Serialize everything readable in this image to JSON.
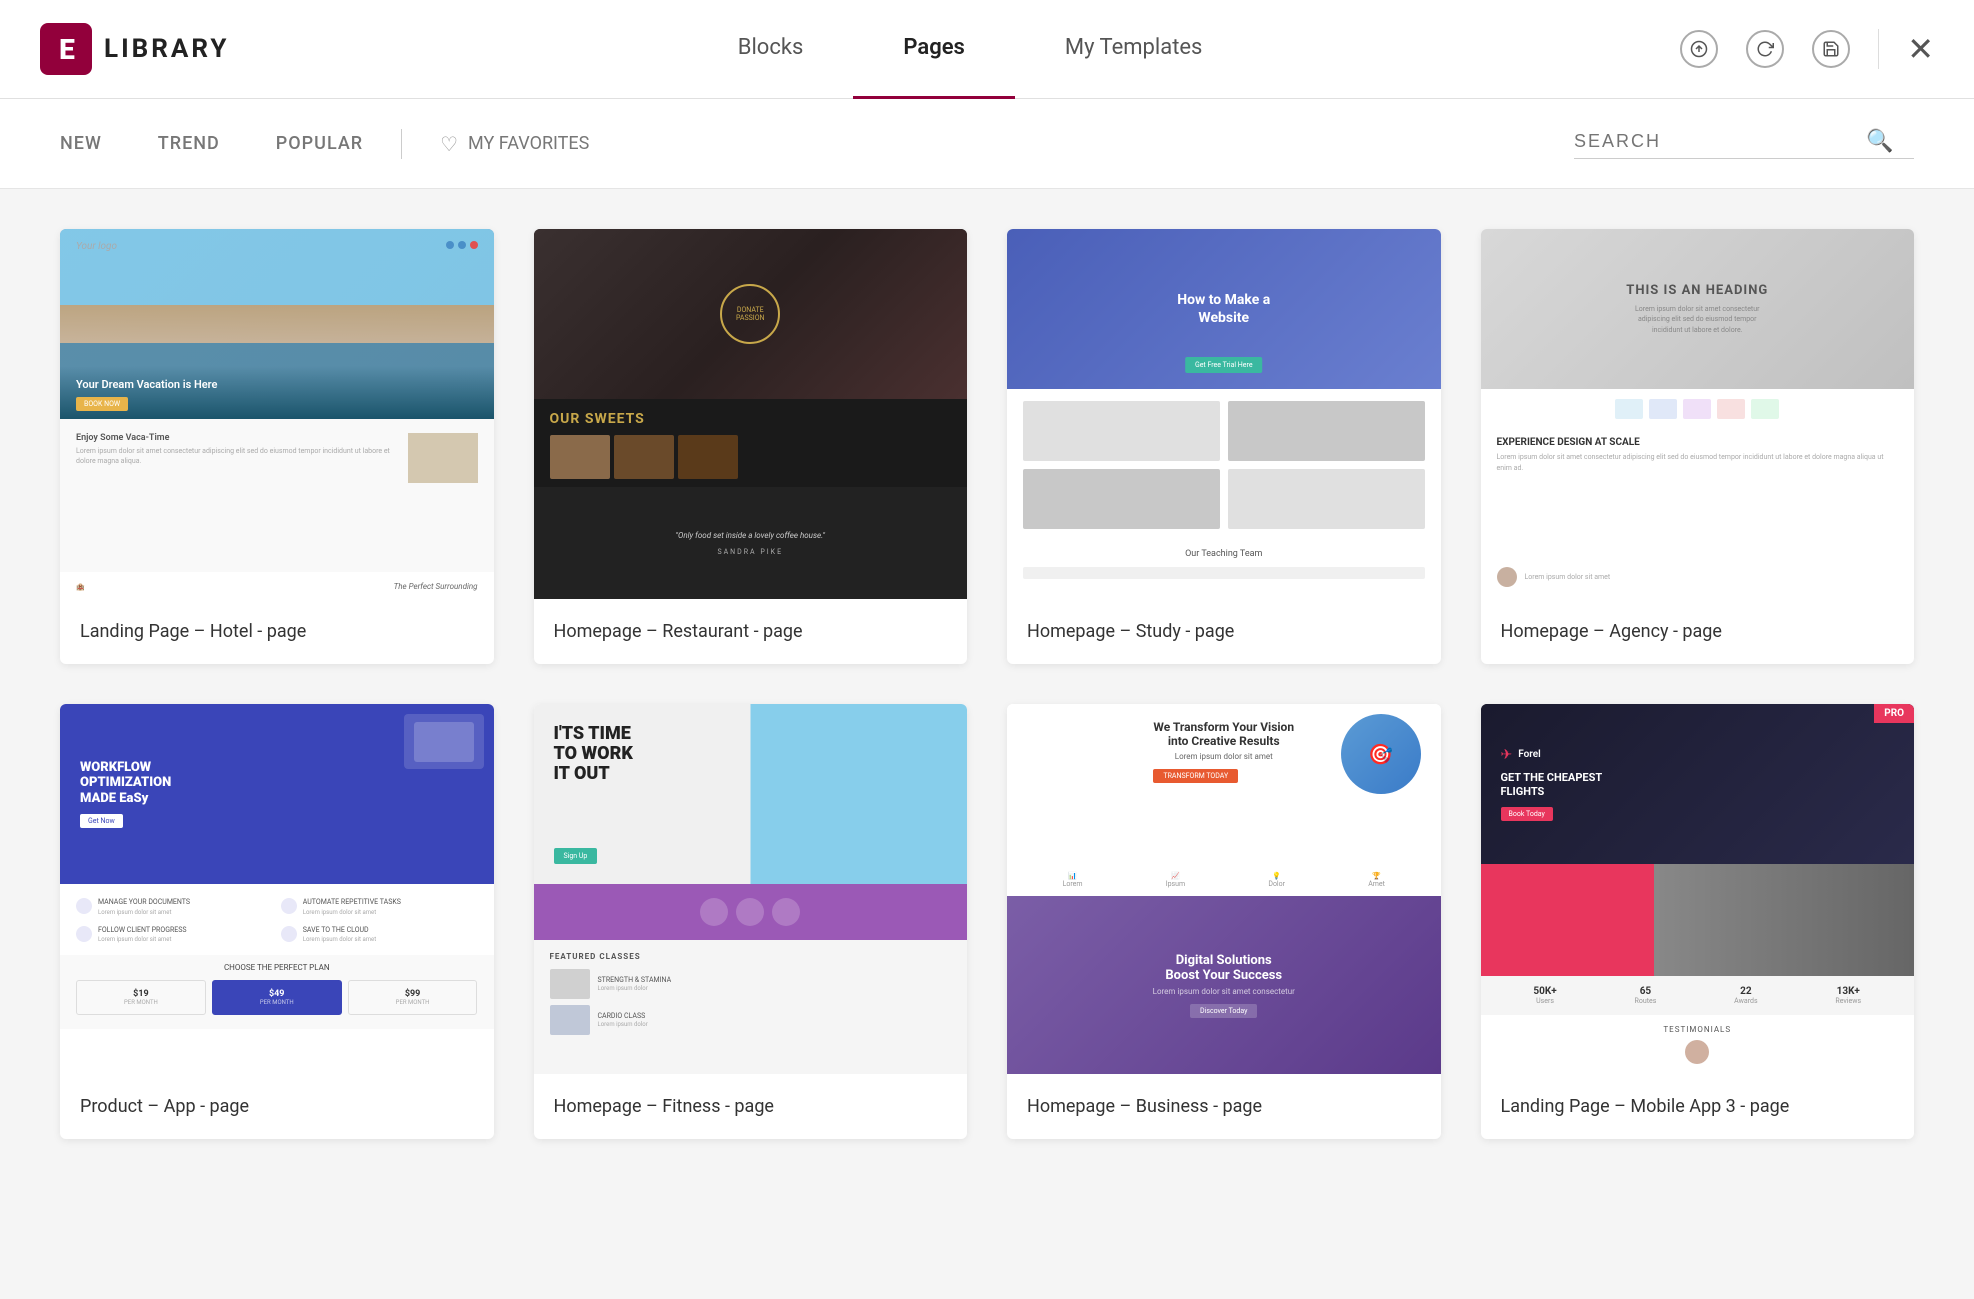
{
  "header": {
    "logo_icon": "E",
    "logo_text": "LIBRARY",
    "tabs": [
      {
        "id": "blocks",
        "label": "Blocks",
        "active": false
      },
      {
        "id": "pages",
        "label": "Pages",
        "active": true
      },
      {
        "id": "my-templates",
        "label": "My Templates",
        "active": false
      }
    ],
    "actions": {
      "upload_title": "Upload",
      "refresh_title": "Refresh",
      "save_title": "Save",
      "close_title": "Close"
    }
  },
  "filter": {
    "items": [
      {
        "id": "new",
        "label": "NEW"
      },
      {
        "id": "trend",
        "label": "TREND"
      },
      {
        "id": "popular",
        "label": "POPULAR"
      }
    ],
    "favorites_label": "MY FAVORITES",
    "search_placeholder": "SEARCH"
  },
  "cards": [
    {
      "id": "hotel",
      "label": "Landing Page – Hotel - page",
      "type": "hotel"
    },
    {
      "id": "restaurant",
      "label": "Homepage – Restaurant - page",
      "type": "restaurant"
    },
    {
      "id": "study",
      "label": "Homepage – Study - page",
      "type": "study"
    },
    {
      "id": "agency",
      "label": "Homepage – Agency - page",
      "type": "agency"
    },
    {
      "id": "app",
      "label": "Product – App - page",
      "type": "app"
    },
    {
      "id": "fitness",
      "label": "Homepage – Fitness - page",
      "type": "fitness"
    },
    {
      "id": "business",
      "label": "Homepage – Business - page",
      "type": "business"
    },
    {
      "id": "mobile",
      "label": "Landing Page – Mobile App 3 - page",
      "type": "mobile",
      "pro": true
    }
  ],
  "thumbnails": {
    "hotel": {
      "logo": "Your logo",
      "title": "Your Dream Vacation is Here",
      "cta": "BOOK NOW",
      "section_title": "Enjoy Some Vaca-Time",
      "caption": "The Perfect Surrounding"
    },
    "restaurant": {
      "sweets_title": "OUR SWEETS",
      "quote": "\"Only food set inside a lovely coffee house.\"",
      "author": "SANDRA PIKE"
    },
    "study": {
      "hero_title": "How to Make a Website",
      "cta": "Get Free Trial Here",
      "team_title": "Our Teaching Team"
    },
    "agency": {
      "heading": "THIS IS AN HEADING",
      "sub": "EXPERIENCE DESIGN AT SCALE"
    },
    "app": {
      "hero_title": "WORKFLOW OPTIMIZATION MADE EaSy",
      "cta": "Get Now",
      "features": [
        "MANAGE YOUR DOCUMENTS",
        "AUTOMATE REPETITIVE TASKS",
        "FOLLOW CLIENT PROGRESS",
        "SAVE TO THE CLOUD"
      ],
      "pricing_title": "CHOOSE THE PERFECT PLAN",
      "prices": [
        "$19",
        "$49",
        "$99"
      ],
      "price_labels": [
        "PER MONTH",
        "PER MONTH",
        "PER MONTH"
      ]
    },
    "fitness": {
      "hero_title": "I'TS TIME TO WORK IT OUT",
      "cta": "Sign Up",
      "featured_title": "FEATURED CLASSES",
      "classes": [
        "STRENGTH & STAMINA"
      ]
    },
    "business": {
      "hero_title": "We Transform Your Vision into Creative Results",
      "cta": "TRANSFORM TODAY",
      "bottom_title": "Digital Solutions Boost Your Success",
      "bottom_cta": "Discover Today"
    },
    "mobile": {
      "brand": "Forel",
      "hero_title": "GET THE CHEAPEST FLIGHTS",
      "cta": "Book Today",
      "pro_badge": "PRO",
      "stats": [
        "50K+",
        "65",
        "22",
        "13K+"
      ],
      "stat_labels": [
        "",
        "",
        "",
        ""
      ],
      "testimonials_title": "TESTIMONIALS"
    }
  }
}
